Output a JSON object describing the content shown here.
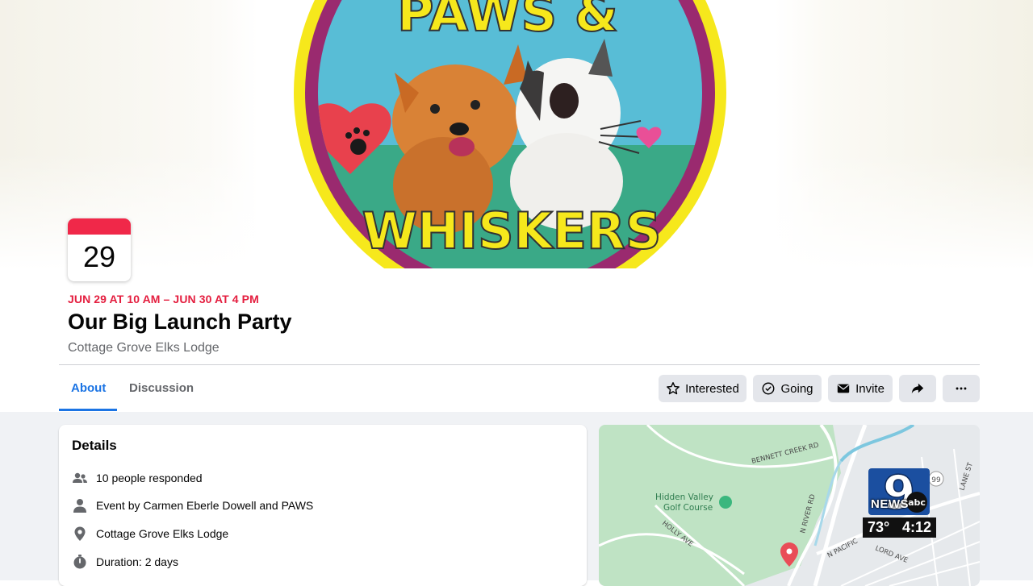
{
  "cover": {
    "top_text": "PAWS &",
    "bottom_text": "WHISKERS",
    "colors": {
      "outer_ring": "#f6e81c",
      "inner_ring": "#9a2a6f",
      "sky": "#58bdd6",
      "ground": "#3aa987"
    }
  },
  "calendar": {
    "day": "29"
  },
  "event": {
    "date_range": "JUN 29 AT 10 AM – JUN 30 AT 4 PM",
    "title": "Our Big Launch Party",
    "location": "Cottage Grove Elks Lodge"
  },
  "tabs": [
    {
      "label": "About",
      "active": true
    },
    {
      "label": "Discussion",
      "active": false
    }
  ],
  "actions": {
    "interested": "Interested",
    "going": "Going",
    "invite": "Invite",
    "share_icon": "share-icon",
    "more_icon": "more-icon"
  },
  "details": {
    "heading": "Details",
    "responded": "10 people responded",
    "event_by_prefix": "Event by ",
    "host_1": "Carmen Eberle Dowell",
    "and": " and ",
    "host_2": "PAWS",
    "place": "Cottage Grove Elks Lodge",
    "duration": "Duration: 2 days"
  },
  "map": {
    "labels": {
      "bennett": "BENNETT CREEK RD",
      "golf": "Hidden Valley",
      "golf2": "Golf Course",
      "holly": "HOLLY AVE",
      "river": "N RIVER RD",
      "pacific": "N PACIFIC",
      "lord": "LORD AVE",
      "lane": "LANE ST",
      "route": "99"
    }
  },
  "overlay": {
    "channel": "9",
    "network": "abc",
    "news": "NEWS",
    "temp": "73°",
    "time": "4:12"
  }
}
